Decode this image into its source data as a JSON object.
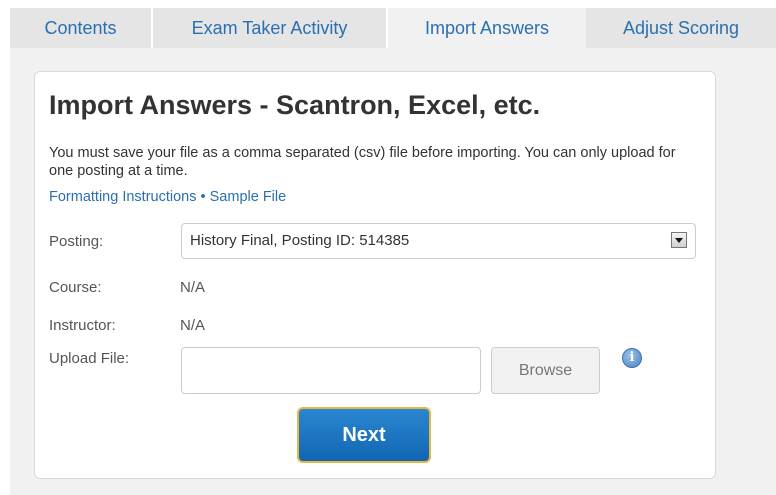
{
  "tabs": [
    {
      "label": "Contents",
      "active": false
    },
    {
      "label": "Exam Taker Activity",
      "active": false
    },
    {
      "label": "Import Answers",
      "active": true
    },
    {
      "label": "Adjust Scoring",
      "active": false
    }
  ],
  "panel": {
    "title": "Import Answers - Scantron, Excel, etc.",
    "description": "You must save your file as a comma separated (csv) file before importing. You can only upload for one posting at a time.",
    "links": {
      "formatting": "Formatting Instructions",
      "separator": "•",
      "sample": "Sample File"
    }
  },
  "form": {
    "posting_label": "Posting:",
    "posting_value": "History Final, Posting ID: 514385",
    "course_label": "Course:",
    "course_value": "N/A",
    "instructor_label": "Instructor:",
    "instructor_value": "N/A",
    "upload_label": "Upload File:",
    "upload_value": "",
    "browse_label": "Browse",
    "info_icon": "info-icon",
    "next_label": "Next"
  },
  "colors": {
    "link": "#2a6fb0",
    "tab_bar": "#e5e5e5",
    "active_tab": "#f1f1f1",
    "next_button": "#1a73c1",
    "next_border": "#e5b842"
  }
}
